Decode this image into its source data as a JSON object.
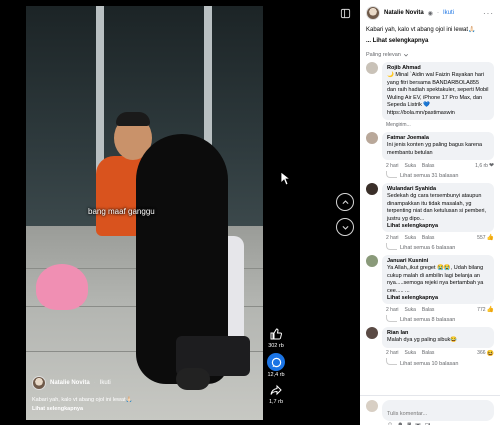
{
  "post": {
    "author": "Natalie Novita",
    "follow_label": "Ikuti",
    "separator": "·",
    "caption": "Kabari yah, kalo vt abang ojol ini lewat🙏🏻",
    "see_more": "... Lihat selengkapnya",
    "video_caption": "Kabari yah, kalo vt abang ojol ini lewat🙏🏻",
    "video_see_more": "Lihat selengkapnya",
    "overlay_text": "bang maaf ganggu"
  },
  "actions": {
    "likes": "302 rb",
    "comments": "12,4 rb",
    "shares": "1,7 rb"
  },
  "panel": {
    "filter_label": "Paling relevan",
    "composer_placeholder": "Tulis komentar..."
  },
  "comments": [
    {
      "name": "Rojib Ahmad",
      "text": "🌙 Minal `Aidin wal Faizin Rayakan hari yang fitri bersama BANDARBOLA855 dan raih hadiah spektakuler, seperti Mobil Wuling Air EV, iPhone 17 Pro Max, dan Sepeda Listrik 💙 https://bola.mn/pastimaswin",
      "more": "",
      "time": "Mengirim...",
      "like": "",
      "reply": "",
      "reactions": "",
      "replies": ""
    },
    {
      "name": "Fatmar Joemala",
      "text": "Ini jenis konten yg paling bagus karena membantu betulan",
      "more": "",
      "time": "2 hari",
      "like": "Suka",
      "reply": "Balas",
      "reactions": "1,6 rb",
      "replies": "Lihat semua 31 balasan"
    },
    {
      "name": "Wulandari Syahida",
      "text": "Sedekah dg cara tersembunyi ataupun dinampakkan itu tidak masalah, yg terpenting niat dan ketulusan si pemberi, justru yg dipo...",
      "more": "Lihat selengkapnya",
      "time": "2 hari",
      "like": "Suka",
      "reply": "Balas",
      "reactions": "557",
      "replies": "Lihat semua 6 balasan"
    },
    {
      "name": "Januari Kusnini",
      "text": "Ya Allah,,ikut greget 😭😭, Udah bilang cukup malah di ambilin lagi belanja an nya.....semoga rejeki nya bertambah ya cee..... ...",
      "more": "Lihat selengkapnya",
      "time": "2 hari",
      "like": "Suka",
      "reply": "Balas",
      "reactions": "772",
      "replies": "Lihat semua 8 balasan"
    },
    {
      "name": "Rian Ian",
      "text": "Malah dya yg paling sibuk😂",
      "more": "",
      "time": "2 hari",
      "like": "Suka",
      "reply": "Balas",
      "reactions": "366",
      "replies": "Lihat semua 10 balasan"
    }
  ]
}
